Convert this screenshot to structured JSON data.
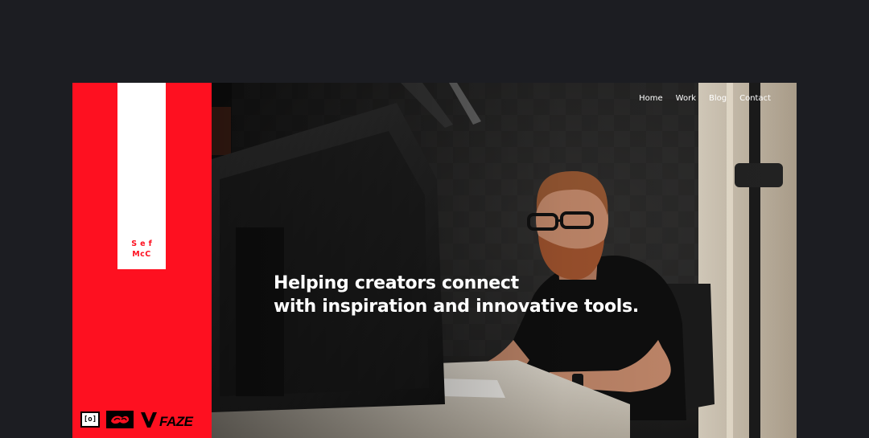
{
  "brand": {
    "logo_line1": "Sef",
    "logo_line2": "McC",
    "accent_color": "#fe1020"
  },
  "nav": {
    "items": [
      {
        "label": "Home"
      },
      {
        "label": "Work"
      },
      {
        "label": "Blog"
      },
      {
        "label": "Contact"
      }
    ]
  },
  "hero": {
    "headline_line1": "Helping creators connect",
    "headline_line2": "with inspiration and innovative tools.",
    "image_description": "photo-of-man-at-computer"
  },
  "partners": [
    {
      "name": "bracket-logo",
      "label": "[o]"
    },
    {
      "name": "ram-logo-icon"
    },
    {
      "name": "faze-logo",
      "label": "FAZE"
    }
  ],
  "colors": {
    "page_background": "#1c1d22",
    "text": "#ffffff"
  }
}
